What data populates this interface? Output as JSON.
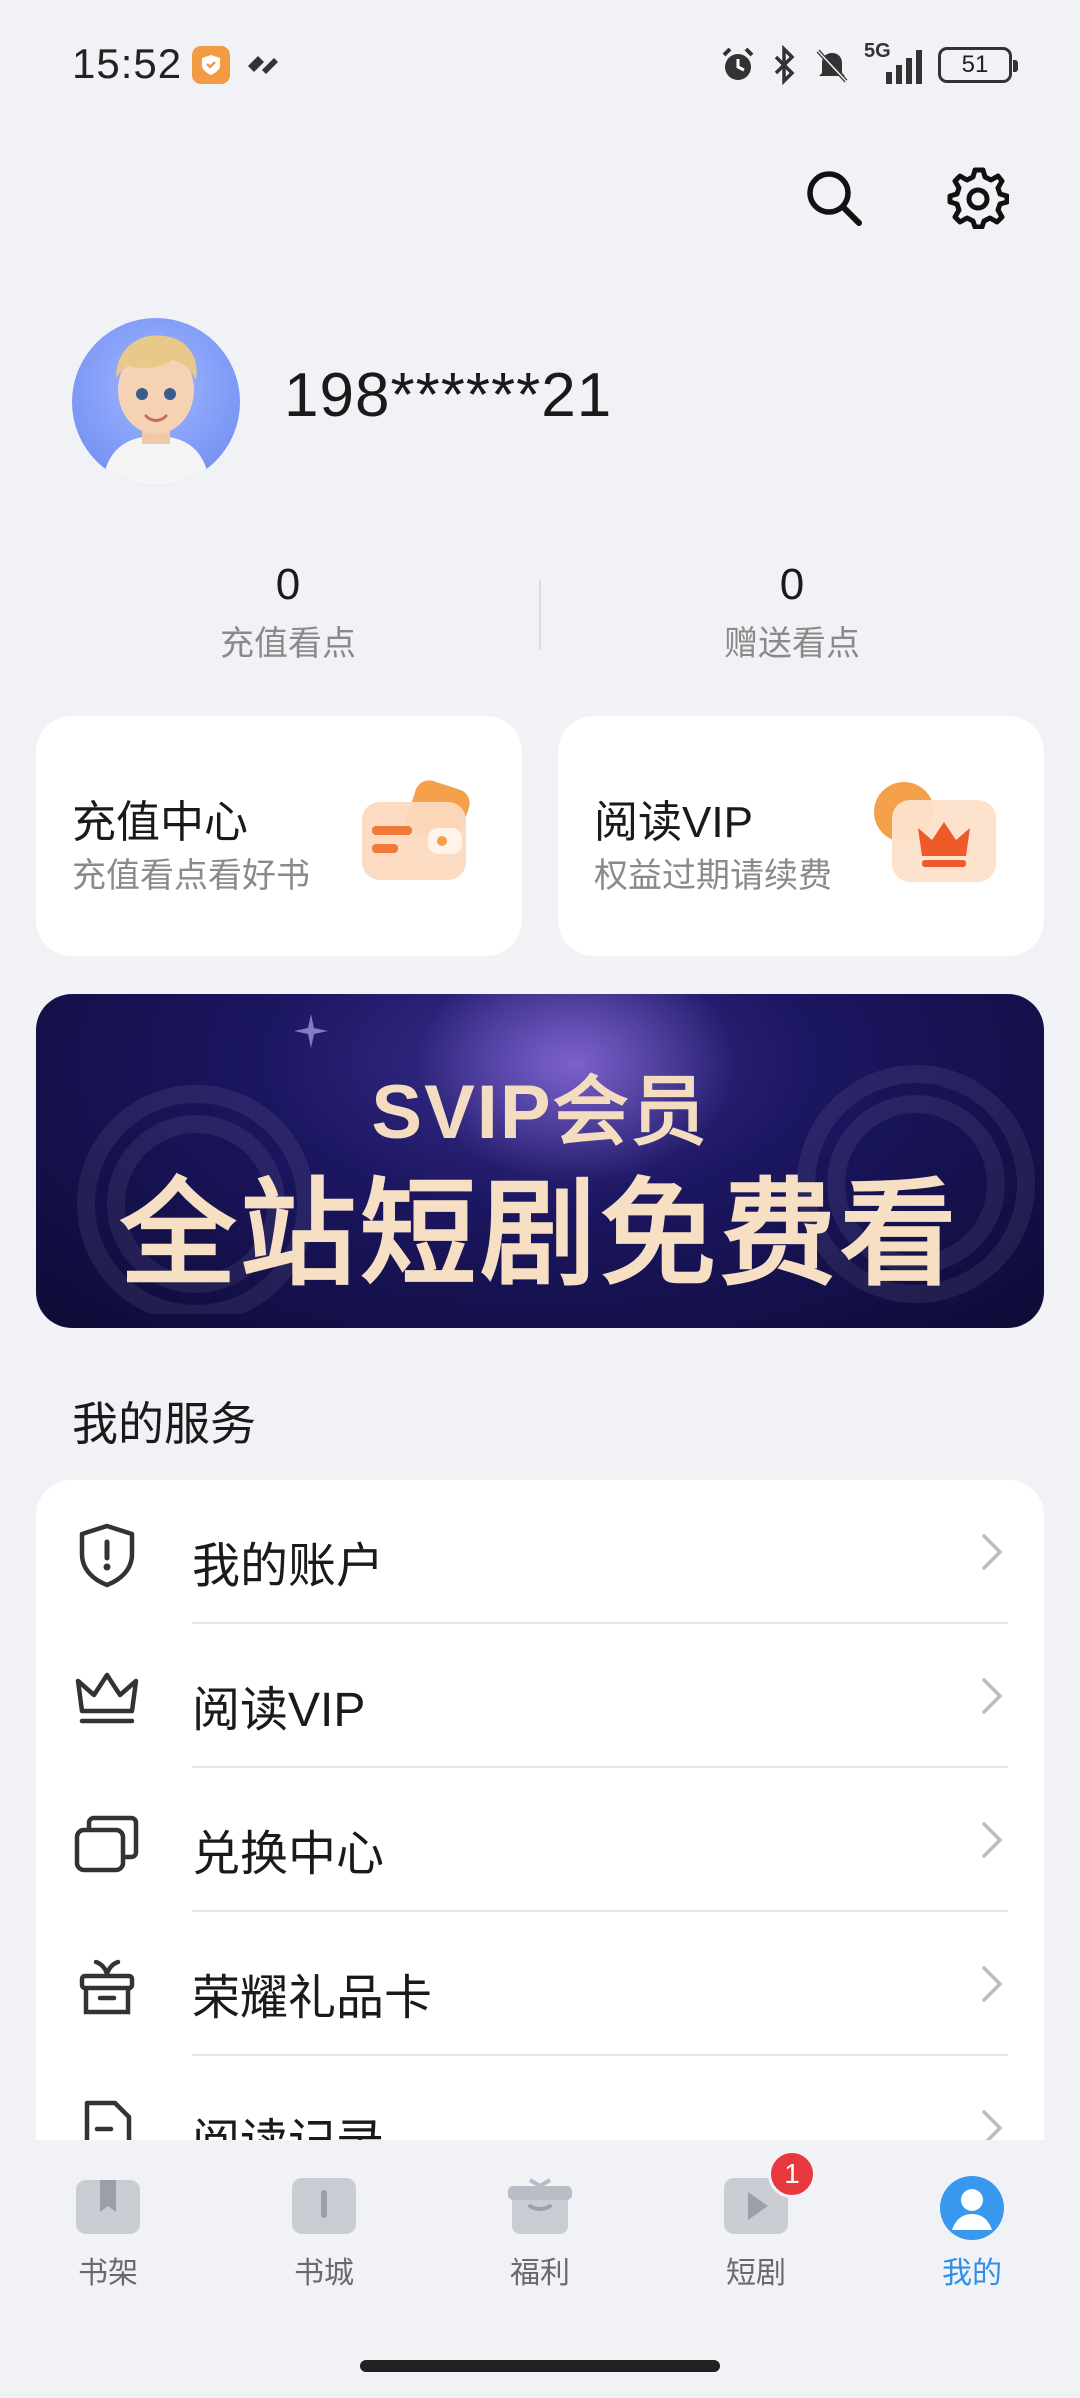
{
  "status_bar": {
    "time": "15:52",
    "network": "5G",
    "battery": "51",
    "icons": [
      "alarm-icon",
      "bluetooth-icon",
      "mute-icon",
      "signal-icon",
      "battery-icon"
    ]
  },
  "header": {
    "search_icon": "search-icon",
    "settings_icon": "gear-icon"
  },
  "profile": {
    "username": "198******21"
  },
  "points": {
    "recharge_value": "0",
    "recharge_label": "充值看点",
    "gift_value": "0",
    "gift_label": "赠送看点"
  },
  "cards": {
    "recharge": {
      "title": "充值中心",
      "subtitle": "充值看点看好书"
    },
    "vip": {
      "title": "阅读VIP",
      "subtitle": "权益过期请续费"
    }
  },
  "banner": {
    "line1": "SVIP会员",
    "line2": "全站短剧免费看"
  },
  "services": {
    "title": "我的服务",
    "items": [
      {
        "label": "我的账户",
        "icon": "shield-alert-icon"
      },
      {
        "label": "阅读VIP",
        "icon": "crown-icon"
      },
      {
        "label": "兑换中心",
        "icon": "cards-icon"
      },
      {
        "label": "荣耀礼品卡",
        "icon": "gift-icon"
      },
      {
        "label": "阅读记录",
        "icon": "document-icon"
      }
    ]
  },
  "bottom_nav": {
    "items": [
      {
        "label": "书架",
        "icon": "bookshelf-icon"
      },
      {
        "label": "书城",
        "icon": "book-icon"
      },
      {
        "label": "福利",
        "icon": "gift-box-icon"
      },
      {
        "label": "短剧",
        "icon": "play-icon",
        "badge": "1"
      },
      {
        "label": "我的",
        "icon": "profile-icon",
        "active": true
      }
    ]
  },
  "colors": {
    "accent": "#2f8fe8",
    "badge": "#e8383d",
    "background": "#f1f2f6",
    "orange": "#f28a3a"
  }
}
